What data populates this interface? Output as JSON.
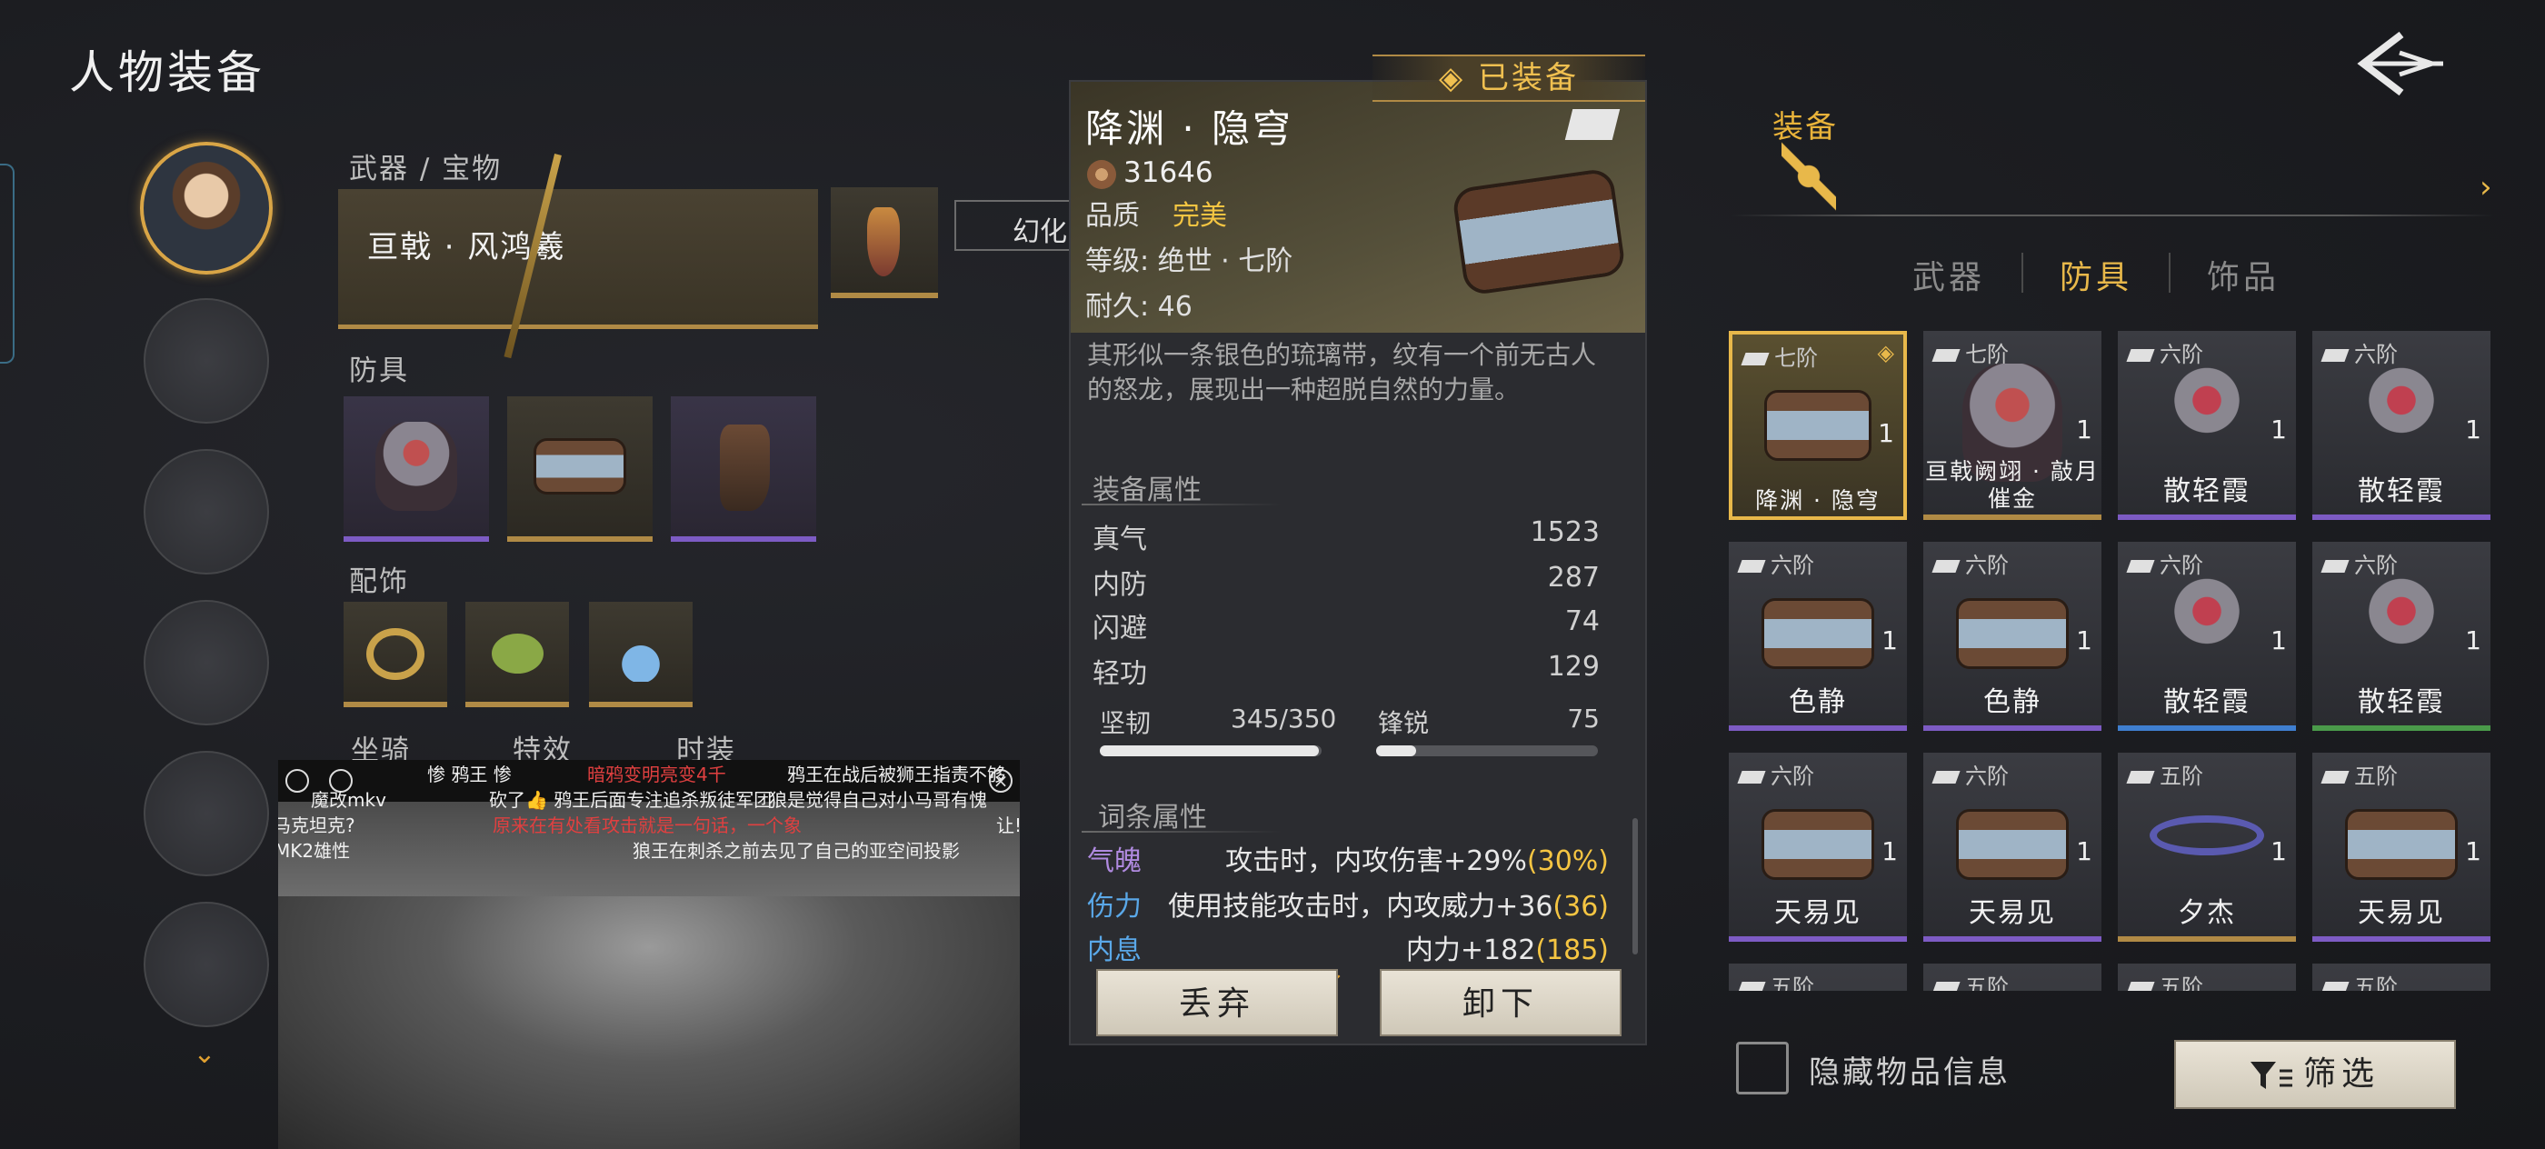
{
  "page_title": "人物装备",
  "left": {
    "weapon_section": "武器 / 宝物",
    "weapon_name": "亘戟 · 风鸿羲",
    "huanhua": "幻化",
    "armor_section": "防具",
    "accessory_section": "配饰",
    "mount": "坐骑",
    "effects": "特效",
    "fashion": "时装"
  },
  "video": {
    "danmu": [
      "惨 鸦王 惨",
      "暗鸦变明亮变4千",
      "鸦王在战后被狮王指责不够",
      "魔改mkv",
      "砍了👍 鸦王后面专注追杀叛徒军团",
      "狼是觉得自己对小马哥有愧",
      "马克坦克?",
      "原来在有处看攻击就是一句话，一个象",
      "让!",
      "MK2雄性",
      "狼王在刺杀之前去见了自己的亚空间投影"
    ]
  },
  "detail": {
    "equipped_badge": "◈ 已装备",
    "name": "降渊 · 隐穹",
    "power": "31646",
    "quality_label": "品质",
    "quality_value": "完美",
    "level": "等级: 绝世 · 七阶",
    "durability": "耐久: 46",
    "description": "其形似一条银色的琉璃带，纹有一个前无古人的怒龙，展现出一种超脱自然的力量。",
    "attr_title": "装备属性",
    "stats": [
      {
        "name": "真气",
        "value": "1523"
      },
      {
        "name": "内防",
        "value": "287"
      },
      {
        "name": "闪避",
        "value": "74"
      },
      {
        "name": "轻功",
        "value": "129"
      }
    ],
    "toughness_label": "坚韧",
    "toughness_value": "345/350",
    "toughness_ratio": 0.986,
    "sharp_label": "锋锐",
    "sharp_value": "75",
    "sharp_ratio": 0.18,
    "affix_title": "词条属性",
    "affixes": [
      {
        "name": "气魄",
        "text": "攻击时，内攻伤害+29%",
        "extra": "(30%)",
        "color": "#b08ae0"
      },
      {
        "name": "伤力",
        "text": "使用技能攻击时，内攻威力+36",
        "extra": "(36)",
        "color": "#5aa8e8"
      },
      {
        "name": "内息",
        "text": "内力+182",
        "extra": "(185)",
        "color": "#5aa8e8"
      }
    ],
    "discard_btn": "丢弃",
    "unequip_btn": "卸下"
  },
  "right": {
    "equip_label": "装备",
    "tabs": [
      "武器",
      "防具",
      "饰品"
    ],
    "active_tab": "防具",
    "items": [
      {
        "tier": "七阶",
        "name": "降渊 · 隐穹",
        "count": "1",
        "icon": "belt",
        "rarity": "gold",
        "selected": true
      },
      {
        "tier": "七阶",
        "name": "亘戟阙翊 · 敲月催金",
        "count": "1",
        "icon": "armor",
        "rarity": "gold"
      },
      {
        "tier": "六阶",
        "name": "散轻霞",
        "count": "1",
        "icon": "mask",
        "rarity": "purple"
      },
      {
        "tier": "六阶",
        "name": "散轻霞",
        "count": "1",
        "icon": "mask",
        "rarity": "purple"
      },
      {
        "tier": "六阶",
        "name": "色静",
        "count": "1",
        "icon": "belt",
        "rarity": "purple"
      },
      {
        "tier": "六阶",
        "name": "色静",
        "count": "1",
        "icon": "belt",
        "rarity": "purple"
      },
      {
        "tier": "六阶",
        "name": "散轻霞",
        "count": "1",
        "icon": "mask",
        "rarity": "blue"
      },
      {
        "tier": "六阶",
        "name": "散轻霞",
        "count": "1",
        "icon": "mask",
        "rarity": "green"
      },
      {
        "tier": "六阶",
        "name": "天易见",
        "count": "1",
        "icon": "belt",
        "rarity": "purple"
      },
      {
        "tier": "六阶",
        "name": "天易见",
        "count": "1",
        "icon": "belt",
        "rarity": "purple"
      },
      {
        "tier": "五阶",
        "name": "夕杰",
        "count": "1",
        "icon": "sash",
        "rarity": "gold"
      },
      {
        "tier": "五阶",
        "name": "天易见",
        "count": "1",
        "icon": "belt",
        "rarity": "purple"
      },
      {
        "tier": "五阶",
        "name": "",
        "count": "",
        "icon": "",
        "rarity": "gold"
      },
      {
        "tier": "五阶",
        "name": "",
        "count": "",
        "icon": "",
        "rarity": "gold"
      },
      {
        "tier": "五阶",
        "name": "",
        "count": "",
        "icon": "",
        "rarity": "gold"
      },
      {
        "tier": "五阶",
        "name": "",
        "count": "",
        "icon": "",
        "rarity": "gold"
      }
    ],
    "hide_info": "隐藏物品信息",
    "filter": "筛选"
  }
}
